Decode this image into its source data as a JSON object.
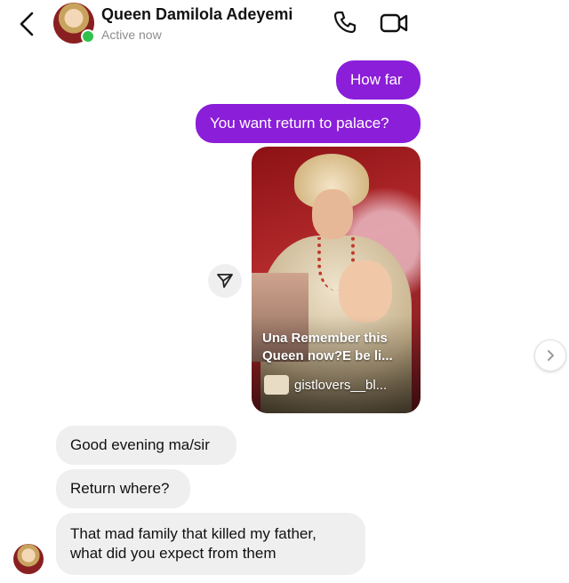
{
  "header": {
    "contact_name": "Queen Damilola Adeyemi",
    "status": "Active now",
    "icons": {
      "back": "chevron-left-icon",
      "call": "phone-icon",
      "video": "video-camera-icon",
      "online": "online-indicator"
    }
  },
  "messages": {
    "outgoing": [
      {
        "text": "How far"
      },
      {
        "text": "You want return to palace?"
      }
    ],
    "shared_post": {
      "caption": "Una Remember this Queen now?E be li...",
      "account": "gistlovers__bl..."
    },
    "incoming": [
      {
        "text": "Good evening ma/sir"
      },
      {
        "text": "Return where?"
      },
      {
        "text": "That mad family that killed my father, what did you expect from them"
      }
    ]
  },
  "colors": {
    "outgoing_bubble": "#8b1ed8",
    "incoming_bubble": "#efefef",
    "online_dot": "#31c24d"
  }
}
